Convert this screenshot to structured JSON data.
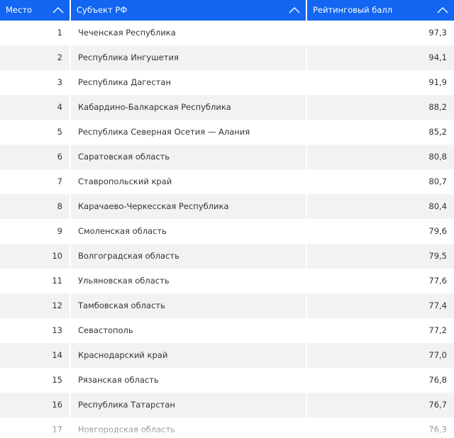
{
  "header": {
    "col_rank": "Место",
    "col_region": "Субъект РФ",
    "col_score": "Рейтинговый балл"
  },
  "rows": [
    {
      "rank": "1",
      "region": "Чеченская Республика",
      "score": "97,3"
    },
    {
      "rank": "2",
      "region": "Республика Ингушетия",
      "score": "94,1"
    },
    {
      "rank": "3",
      "region": "Республика Дагестан",
      "score": "91,9"
    },
    {
      "rank": "4",
      "region": "Кабардино-Балкарская Республика",
      "score": "88,2"
    },
    {
      "rank": "5",
      "region": "Республика Северная Осетия — Алания",
      "score": "85,2"
    },
    {
      "rank": "6",
      "region": "Саратовская область",
      "score": "80,8"
    },
    {
      "rank": "7",
      "region": "Ставропольский край",
      "score": "80,7"
    },
    {
      "rank": "8",
      "region": "Карачаево-Черкесская Республика",
      "score": "80,4"
    },
    {
      "rank": "9",
      "region": "Смоленская область",
      "score": "79,6"
    },
    {
      "rank": "10",
      "region": "Волгоградская область",
      "score": "79,5"
    },
    {
      "rank": "11",
      "region": "Ульяновская область",
      "score": "77,6"
    },
    {
      "rank": "12",
      "region": "Тамбовская область",
      "score": "77,4"
    },
    {
      "rank": "13",
      "region": "Севастополь",
      "score": "77,2"
    },
    {
      "rank": "14",
      "region": "Краснодарский край",
      "score": "77,0"
    },
    {
      "rank": "15",
      "region": "Рязанская область",
      "score": "76,8"
    },
    {
      "rank": "16",
      "region": "Республика Татарстан",
      "score": "76,7"
    },
    {
      "rank": "17",
      "region": "Новгородская область",
      "score": "76,3"
    }
  ],
  "icons": {
    "sort": "chevron-up-icon"
  },
  "colors": {
    "header_bg": "#1266f1",
    "header_text": "#ffffff",
    "row_alt": "#f2f2f2"
  }
}
